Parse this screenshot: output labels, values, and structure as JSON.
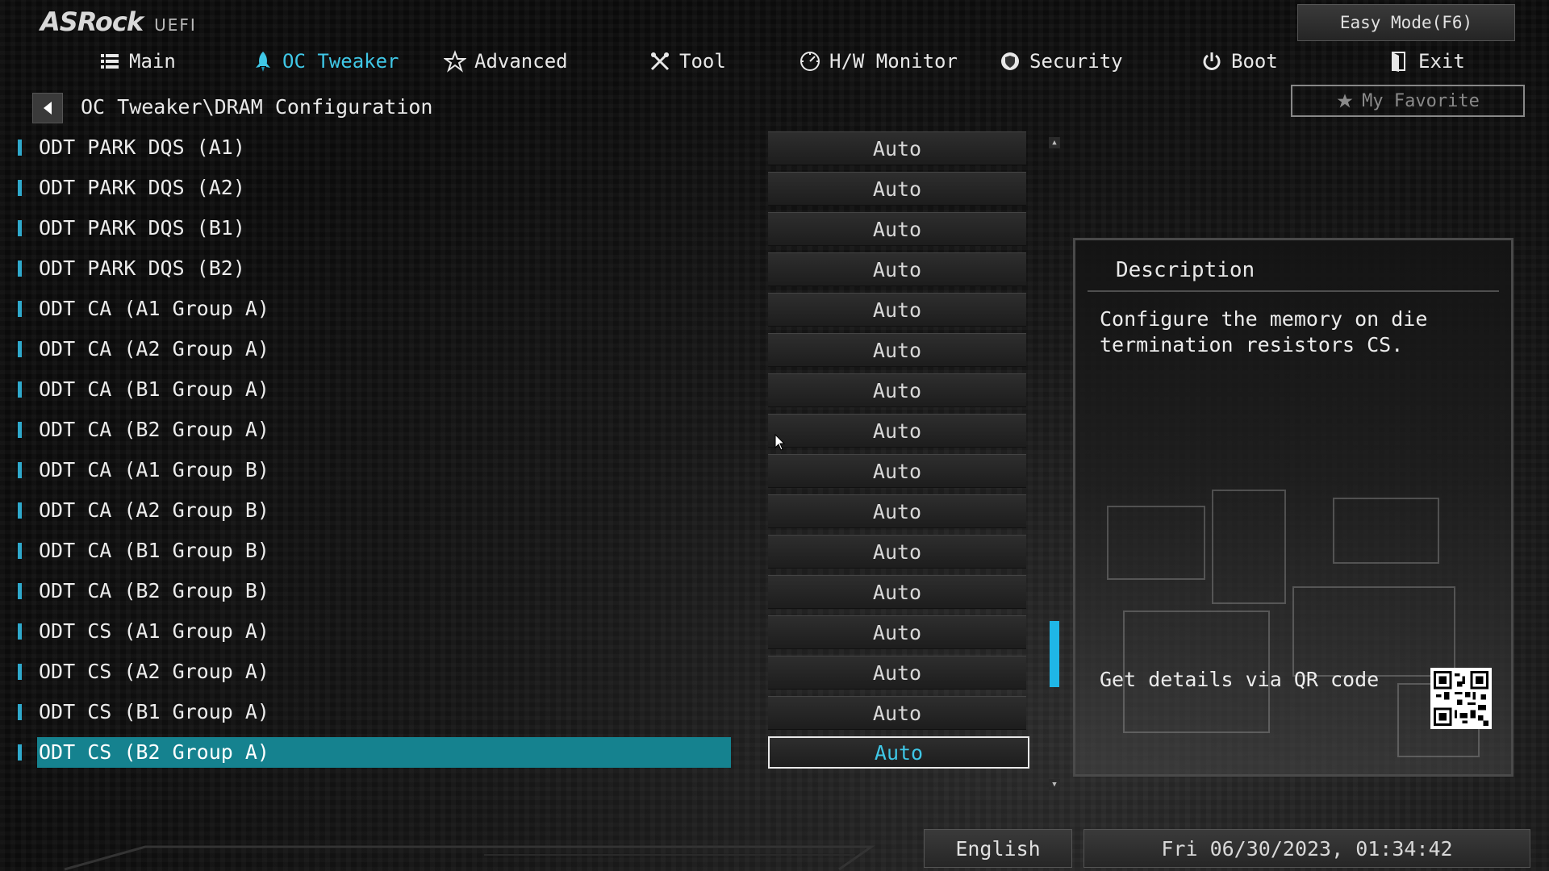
{
  "header": {
    "brand": "ASRock",
    "product": "UEFI",
    "easy_mode_label": "Easy Mode(F6)"
  },
  "nav": {
    "items": [
      {
        "label": "Main",
        "icon": "list-icon"
      },
      {
        "label": "OC Tweaker",
        "icon": "rocket-icon",
        "active": true
      },
      {
        "label": "Advanced",
        "icon": "star-icon"
      },
      {
        "label": "Tool",
        "icon": "tools-icon"
      },
      {
        "label": "H/W Monitor",
        "icon": "gauge-icon"
      },
      {
        "label": "Security",
        "icon": "shield-icon"
      },
      {
        "label": "Boot",
        "icon": "power-icon"
      },
      {
        "label": "Exit",
        "icon": "exit-icon"
      }
    ]
  },
  "breadcrumb": "OC Tweaker\\DRAM Configuration",
  "favorite_label": "My Favorite",
  "settings": [
    {
      "label": "ODT PARK DQS (A1)",
      "value": "Auto"
    },
    {
      "label": "ODT PARK DQS (A2)",
      "value": "Auto"
    },
    {
      "label": "ODT PARK DQS (B1)",
      "value": "Auto"
    },
    {
      "label": "ODT PARK DQS (B2)",
      "value": "Auto"
    },
    {
      "label": "ODT CA (A1 Group A)",
      "value": "Auto"
    },
    {
      "label": "ODT CA (A2 Group A)",
      "value": "Auto"
    },
    {
      "label": "ODT CA (B1 Group A)",
      "value": "Auto"
    },
    {
      "label": "ODT CA (B2 Group A)",
      "value": "Auto"
    },
    {
      "label": "ODT CA (A1 Group B)",
      "value": "Auto"
    },
    {
      "label": "ODT CA (A2 Group B)",
      "value": "Auto"
    },
    {
      "label": "ODT CA (B1 Group B)",
      "value": "Auto"
    },
    {
      "label": "ODT CA (B2 Group B)",
      "value": "Auto"
    },
    {
      "label": "ODT CS (A1 Group A)",
      "value": "Auto"
    },
    {
      "label": "ODT CS (A2 Group A)",
      "value": "Auto"
    },
    {
      "label": "ODT CS (B1 Group A)",
      "value": "Auto"
    },
    {
      "label": "ODT CS (B2 Group A)",
      "value": "Auto",
      "selected": true
    }
  ],
  "description": {
    "title": "Description",
    "text": "Configure the memory on die termination resistors CS.",
    "qr_label": "Get details via QR code"
  },
  "footer": {
    "language": "English",
    "datetime": "Fri 06/30/2023, 01:34:42"
  },
  "colors": {
    "accent": "#3fc7e6",
    "selected_row": "#15828f",
    "scroll_thumb": "#1fb6e6"
  }
}
